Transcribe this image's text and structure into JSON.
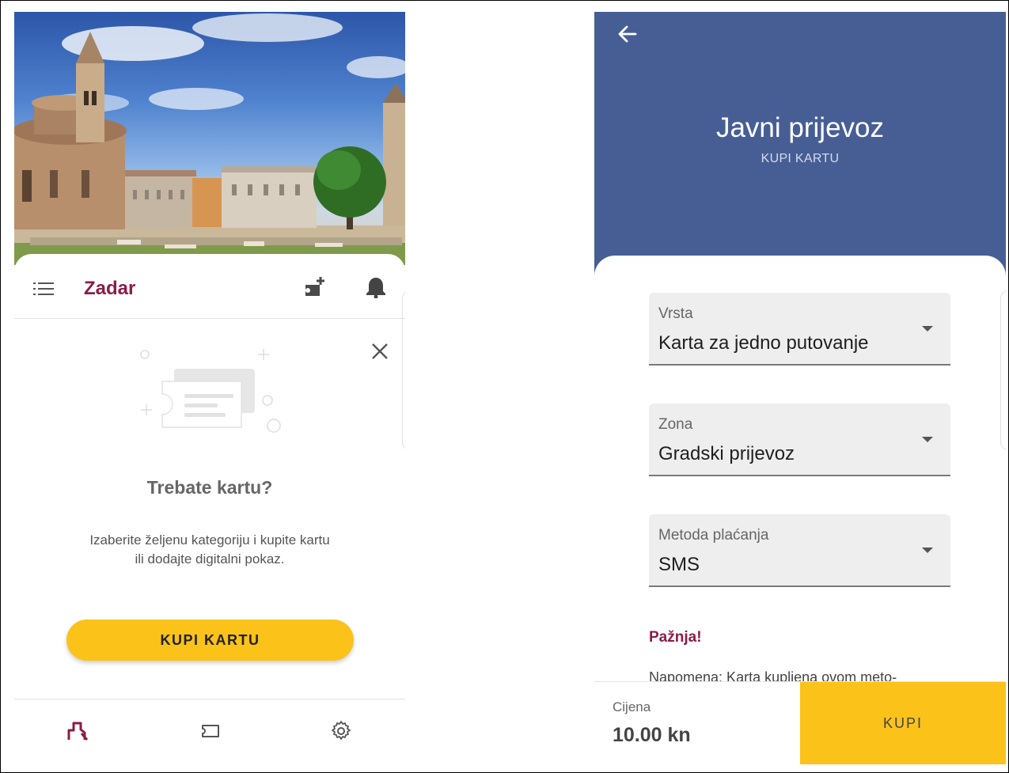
{
  "left": {
    "city_name": "Zadar",
    "empty_state": {
      "title": "Trebate kartu?",
      "description_line1": "Izaberite željenu kategoriju i kupite kartu",
      "description_line2": "ili dodajte digitalni pokaz."
    },
    "buy_button_label": "KUPI KARTU",
    "icons": {
      "menu": "list-menu-icon",
      "add_card": "add-card-icon",
      "notifications": "bell-icon",
      "close": "close-icon",
      "nav": [
        "city-home-icon",
        "ticket-icon",
        "settings-gear-icon"
      ]
    },
    "colors": {
      "accent": "#8b1c4a",
      "button": "#fbc21a"
    }
  },
  "right": {
    "header": {
      "title": "Javni prijevoz",
      "subtitle": "KUPI KARTU"
    },
    "fields": [
      {
        "label": "Vrsta",
        "value": "Karta za jedno putovanje"
      },
      {
        "label": "Zona",
        "value": "Gradski prijevoz"
      },
      {
        "label": "Metoda plaćanja",
        "value": "SMS"
      }
    ],
    "warning_title": "Pažnja!",
    "note_text": "Napomena: Karta kupljena ovom meto-",
    "price_label": "Cijena",
    "price_value": "10.00 kn",
    "buy_button_label": "KUPI",
    "colors": {
      "header": "#475e95",
      "accent": "#8b1c4a",
      "button": "#fbc21a"
    }
  }
}
